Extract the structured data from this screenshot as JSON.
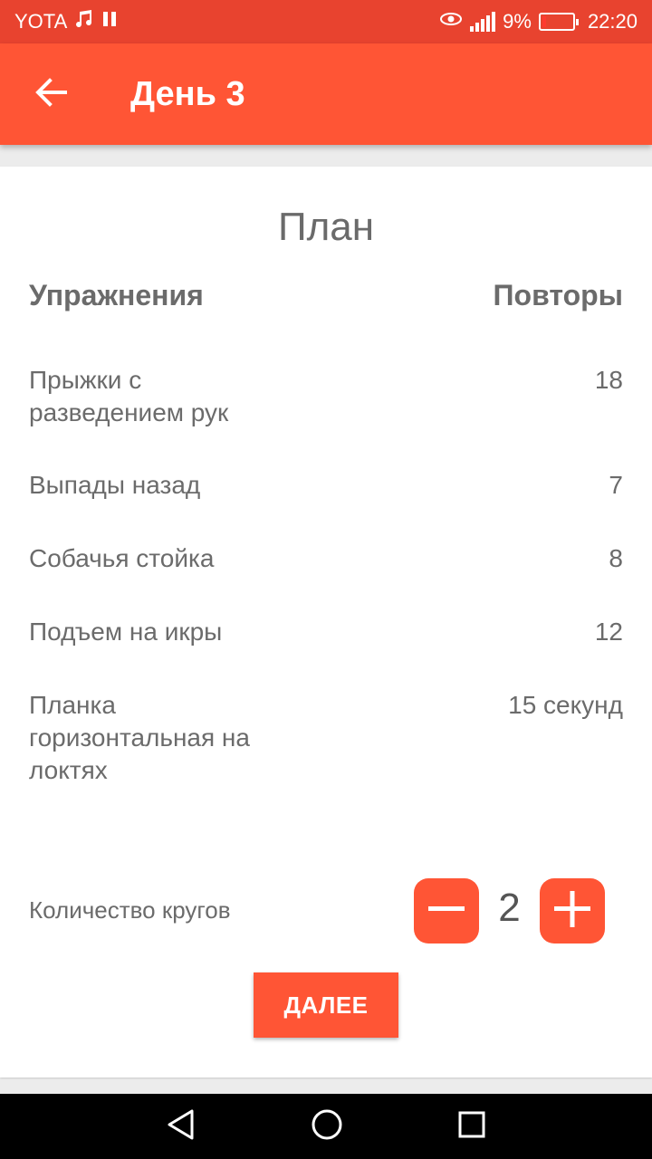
{
  "status_bar": {
    "carrier": "YOTA",
    "battery_percent": "9%",
    "time": "22:20",
    "icons": [
      "music-note-icon",
      "pause-icon",
      "eye-icon",
      "signal-icon",
      "battery-icon"
    ]
  },
  "app_bar": {
    "title": "День 3",
    "back_icon": "arrow-left-icon"
  },
  "plan": {
    "title": "План",
    "columns": [
      "Упражнения",
      "Повторы"
    ],
    "exercises": [
      {
        "name": "Прыжки с разведением рук",
        "reps": "18"
      },
      {
        "name": "Выпады назад",
        "reps": "7"
      },
      {
        "name": "Собачья стойка",
        "reps": "8"
      },
      {
        "name": "Подъем на икры",
        "reps": "12"
      },
      {
        "name": "Планка горизонтальная на локтях",
        "reps": "15 секунд"
      }
    ]
  },
  "rounds": {
    "label": "Количество кругов",
    "value": "2"
  },
  "next_button": "ДАЛЕЕ",
  "colors": {
    "status_bar": "#e8432f",
    "accent": "#ff5535",
    "text": "#6b6b6b"
  }
}
